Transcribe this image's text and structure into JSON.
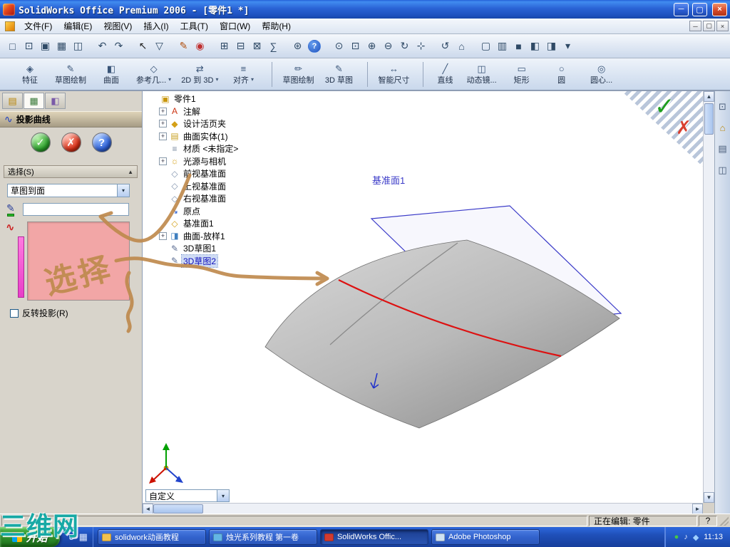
{
  "colors": {
    "annotation-tan": "#bf8a4e",
    "curve-red": "#dd1111",
    "plane-blue": "#3a3ac8",
    "selection-pink": "#f2a6a6",
    "strip-magenta": "#ee4fd0",
    "check-green": "#1e9e1e",
    "cancel-red": "#d84030",
    "watermark-teal": "#17a9a5"
  },
  "ui_glyphs": {
    "accept": "✓",
    "cancel": "✗",
    "help": "?",
    "dropdown": "▾",
    "up": "▲",
    "down": "▼",
    "left": "◄",
    "right": "►",
    "collapse": "▲"
  },
  "titlebar": {
    "title": "SolidWorks Office Premium 2006 - [零件1 *]",
    "minimize": "─",
    "restore": "▢",
    "close": "×"
  },
  "menubar": {
    "items": [
      {
        "name": "menu-file",
        "label": "文件(F)"
      },
      {
        "name": "menu-edit",
        "label": "编辑(E)"
      },
      {
        "name": "menu-view",
        "label": "视图(V)"
      },
      {
        "name": "menu-insert",
        "label": "插入(I)"
      },
      {
        "name": "menu-tools",
        "label": "工具(T)"
      },
      {
        "name": "menu-window",
        "label": "窗口(W)"
      },
      {
        "name": "menu-help",
        "label": "帮助(H)"
      }
    ],
    "minimize": "─",
    "restore": "▢",
    "close": "×"
  },
  "toolbar_standard": {
    "icons": [
      {
        "name": "new-icon",
        "glyph": "□"
      },
      {
        "name": "open-icon",
        "glyph": "⊡"
      },
      {
        "name": "save-icon",
        "glyph": "▣"
      },
      {
        "name": "print-icon",
        "glyph": "▦"
      },
      {
        "name": "print-preview-icon",
        "glyph": "◫"
      },
      {
        "name": "undo-icon",
        "glyph": "↶",
        "gap": true
      },
      {
        "name": "redo-icon",
        "glyph": "↷"
      },
      {
        "name": "select-icon",
        "glyph": "↖",
        "gap": true,
        "color": "#222222"
      },
      {
        "name": "selection-filter-icon",
        "glyph": "▽"
      },
      {
        "name": "sketch-icon",
        "glyph": "✎",
        "gap": true,
        "color": "#b05010"
      },
      {
        "name": "rebuild-icon",
        "glyph": "◉",
        "color": "#c03030"
      },
      {
        "name": "grid-icon",
        "glyph": "⊞",
        "gap": true
      },
      {
        "name": "units-icon",
        "glyph": "⊟"
      },
      {
        "name": "measure-icon",
        "glyph": "⊠"
      },
      {
        "name": "mass-properties-icon",
        "glyph": "∑"
      },
      {
        "name": "options-icon",
        "glyph": "⊛",
        "gap": true
      },
      {
        "name": "help-icon",
        "glyph": "?"
      },
      {
        "name": "zoom-to-fit-icon",
        "glyph": "⊙",
        "gap": true
      },
      {
        "name": "zoom-area-icon",
        "glyph": "⊡"
      },
      {
        "name": "zoom-in-out-icon",
        "glyph": "⊕"
      },
      {
        "name": "zoom-out-icon",
        "glyph": "⊖"
      },
      {
        "name": "rotate-view-icon",
        "glyph": "↻"
      },
      {
        "name": "pan-icon",
        "glyph": "⊹"
      },
      {
        "name": "refresh-icon",
        "glyph": "↺",
        "gap": true
      },
      {
        "name": "view-orientation-icon",
        "glyph": "⌂"
      },
      {
        "name": "wireframe-icon",
        "glyph": "▢",
        "gap": true
      },
      {
        "name": "hidden-lines-icon",
        "glyph": "▥"
      },
      {
        "name": "shaded-icon",
        "glyph": "■"
      },
      {
        "name": "shadows-icon",
        "glyph": "◧"
      },
      {
        "name": "section-view-icon",
        "glyph": "◨"
      },
      {
        "name": "view-dropdown-icon",
        "glyph": "▾"
      }
    ]
  },
  "toolbar_features": {
    "items": [
      {
        "name": "features-tab",
        "glyph": "◈",
        "label": "特征"
      },
      {
        "name": "sketch-tab",
        "glyph": "✎",
        "label": "草图绘制"
      },
      {
        "name": "surfaces-tab",
        "glyph": "◧",
        "label": "曲面"
      },
      {
        "name": "reference-geometry-tab",
        "glyph": "◇",
        "label": "参考几...",
        "arrow": true
      },
      {
        "name": "2d-to-3d-tab",
        "glyph": "⇄",
        "label": "2D 到 3D",
        "arrow": true
      },
      {
        "name": "align-tab",
        "glyph": "≡",
        "label": "对齐",
        "arrow": true
      },
      {
        "name": "sketch-button",
        "glyph": "✏",
        "label": "草图绘制",
        "sep": true
      },
      {
        "name": "3d-sketch-button",
        "glyph": "✎",
        "label": "3D 草图"
      },
      {
        "name": "smart-dimension-button",
        "glyph": "↔",
        "label": "智能尺寸",
        "sep": true
      },
      {
        "name": "line-button",
        "glyph": "╱",
        "label": "直线",
        "sep": true
      },
      {
        "name": "dynamic-mirror-button",
        "glyph": "◫",
        "label": "动态镜..."
      },
      {
        "name": "rectangle-button",
        "glyph": "▭",
        "label": "矩形"
      },
      {
        "name": "circle-button",
        "glyph": "○",
        "label": "圆"
      },
      {
        "name": "centerpoint-arc-button",
        "glyph": "◎",
        "label": "圆心..."
      }
    ]
  },
  "panel": {
    "tabs": [
      {
        "name": "featuremanager-tab",
        "glyph": "▤",
        "color": "#b8860b"
      },
      {
        "name": "propertymanager-tab",
        "glyph": "▦",
        "color": "#3a7a3a",
        "active": true
      },
      {
        "name": "configurationmanager-tab",
        "glyph": "◧",
        "color": "#7a5aa8"
      }
    ],
    "title": "投影曲线",
    "title_icon": "∿",
    "section_header": "选择(S)",
    "dropdown_value": "草图到面",
    "sketch_icon": "✎",
    "face_icon": "∿",
    "checkbox_label": "反转投影(R)"
  },
  "tree": {
    "items": [
      {
        "name": "part-root",
        "glyph": "▣",
        "color": "#c8960c",
        "label": "零件1",
        "indent": 0
      },
      {
        "name": "annotations",
        "plus": "+",
        "glyph": "A",
        "color": "#cc3311",
        "label": "注解",
        "indent": 1
      },
      {
        "name": "design-binder",
        "plus": "+",
        "glyph": "◆",
        "color": "#d4a017",
        "label": "设计活页夹",
        "indent": 1
      },
      {
        "name": "surface-bodies",
        "plus": "+",
        "glyph": "▤",
        "color": "#c9a227",
        "label": "曲面实体(1)",
        "indent": 1
      },
      {
        "name": "material",
        "glyph": "≡",
        "color": "#7a8ba0",
        "label": "材质 <未指定>",
        "indent": 1
      },
      {
        "name": "lights-cameras",
        "plus": "+",
        "glyph": "☼",
        "color": "#d4a017",
        "label": "光源与相机",
        "indent": 1
      },
      {
        "name": "front-plane",
        "glyph": "◇",
        "color": "#8294ad",
        "label": "前视基准面",
        "indent": 1
      },
      {
        "name": "top-plane",
        "glyph": "◇",
        "color": "#8294ad",
        "label": "上视基准面",
        "indent": 1
      },
      {
        "name": "right-plane",
        "glyph": "◇",
        "color": "#8294ad",
        "label": "右视基准面",
        "indent": 1
      },
      {
        "name": "origin",
        "glyph": "↘",
        "color": "#2b5fd0",
        "label": "原点",
        "indent": 1
      },
      {
        "name": "plane1",
        "glyph": "◇",
        "color": "#d4a017",
        "label": "基准面1",
        "indent": 1
      },
      {
        "name": "surface-loft",
        "plus": "+",
        "glyph": "◨",
        "color": "#3f7fbf",
        "label": "曲面-放样1",
        "indent": 1
      },
      {
        "name": "sketch3d-1",
        "glyph": "✎",
        "color": "#5a6c92",
        "label": "3D草图1",
        "indent": 1
      },
      {
        "name": "sketch3d-2",
        "glyph": "✎",
        "color": "#5a6c92",
        "label": "3D草图2",
        "indent": 1,
        "state": "selected"
      }
    ]
  },
  "viewport": {
    "plane_label": "基准面1",
    "custom_combo": "自定义"
  },
  "right_strip": {
    "icons": [
      {
        "name": "fullscreen-icon",
        "glyph": "⊡",
        "color": "#4a5e7a"
      },
      {
        "name": "home-view-icon",
        "glyph": "⌂",
        "color": "#b8860b"
      },
      {
        "name": "feature-display-icon",
        "glyph": "▤",
        "color": "#4a5e7a"
      },
      {
        "name": "pane-split-icon",
        "glyph": "◫",
        "color": "#4a5e7a"
      }
    ]
  },
  "statusbar": {
    "editing": "正在编辑: 零件",
    "help": "?"
  },
  "taskbar": {
    "start": "开始",
    "quick_launch": [
      {
        "name": "ie-quicklaunch-icon",
        "glyph": "e"
      },
      {
        "name": "desktop-quicklaunch-icon",
        "glyph": "▦"
      }
    ],
    "tasks": [
      {
        "name": "task-folder-solidwork-tutorial",
        "label": "solidwork动画教程",
        "icon_color": "#f2c14e"
      },
      {
        "name": "task-candlelight-tutorial",
        "label": "烛光系列教程 第一卷",
        "icon_color": "#63b5e5"
      },
      {
        "name": "task-solidworks",
        "label": "SolidWorks Offic...",
        "icon_color": "#d23b2f",
        "active": true
      },
      {
        "name": "task-photoshop",
        "label": "Adobe Photoshop",
        "icon_color": "#cfe2f3"
      }
    ],
    "tray": [
      {
        "name": "antivirus-tray-icon",
        "glyph": "●",
        "color": "#46c846"
      },
      {
        "name": "volume-tray-icon",
        "glyph": "♪",
        "color": "#dce6ff"
      },
      {
        "name": "messenger-tray-icon",
        "glyph": "◆",
        "color": "#9fd0ff"
      }
    ],
    "time": "11:13"
  },
  "watermark": "三维网",
  "annotations": {
    "select_text": "选择"
  }
}
